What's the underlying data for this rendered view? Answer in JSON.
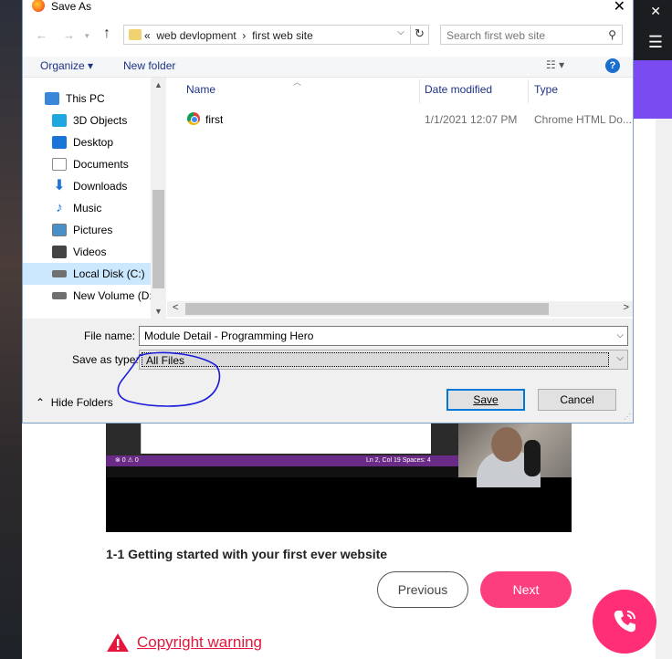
{
  "dialog": {
    "title": "Save As",
    "close": "✕",
    "breadcrumb": [
      "«",
      "web devlopment",
      "›",
      "first web site"
    ],
    "search_placeholder": "Search first web site",
    "toolbar": {
      "organize": "Organize ▾",
      "new_folder": "New folder",
      "help": "?"
    },
    "nav_tree": [
      {
        "label": "This PC",
        "icon": "pc-icon",
        "color": "#3a86d8"
      },
      {
        "label": "3D Objects",
        "icon": "cube-icon",
        "color": "#1fa7e0"
      },
      {
        "label": "Desktop",
        "icon": "desktop-icon",
        "color": "#1a73d6"
      },
      {
        "label": "Documents",
        "icon": "document-icon",
        "color": "#8a8a8a"
      },
      {
        "label": "Downloads",
        "icon": "download-icon",
        "color": "#1a73d6"
      },
      {
        "label": "Music",
        "icon": "music-icon",
        "color": "#1a73d6"
      },
      {
        "label": "Pictures",
        "icon": "pictures-icon",
        "color": "#4a90c8"
      },
      {
        "label": "Videos",
        "icon": "videos-icon",
        "color": "#444444"
      },
      {
        "label": "Local Disk (C:)",
        "icon": "drive-icon",
        "color": "#707070",
        "selected": true
      },
      {
        "label": "New Volume (D:",
        "icon": "drive-icon",
        "color": "#707070"
      }
    ],
    "columns": {
      "name": "Name",
      "date": "Date modified",
      "type": "Type"
    },
    "files": [
      {
        "name": "first",
        "date": "1/1/2021 12:07 PM",
        "type": "Chrome HTML Do..."
      }
    ],
    "file_name_label": "File name:",
    "file_name_value": "Module Detail - Programming Hero",
    "save_type_label": "Save as type:",
    "save_type_value": "All Files",
    "hide_folders": "Hide Folders",
    "save_label": "Save",
    "cancel_label": "Cancel"
  },
  "background": {
    "lesson_title": "1-1 Getting started with your first ever website",
    "previous": "Previous",
    "next": "Next",
    "copyright": "Copyright warning",
    "video_status": "Ln 2, Col 19   Spaces: 4",
    "video_errors": "⊗ 0 ⚠ 0"
  },
  "colors": {
    "accent": "#fc3d7e",
    "purple": "#7b4bf2",
    "selection": "#cce8ff",
    "annotation": "#1a1adb"
  }
}
